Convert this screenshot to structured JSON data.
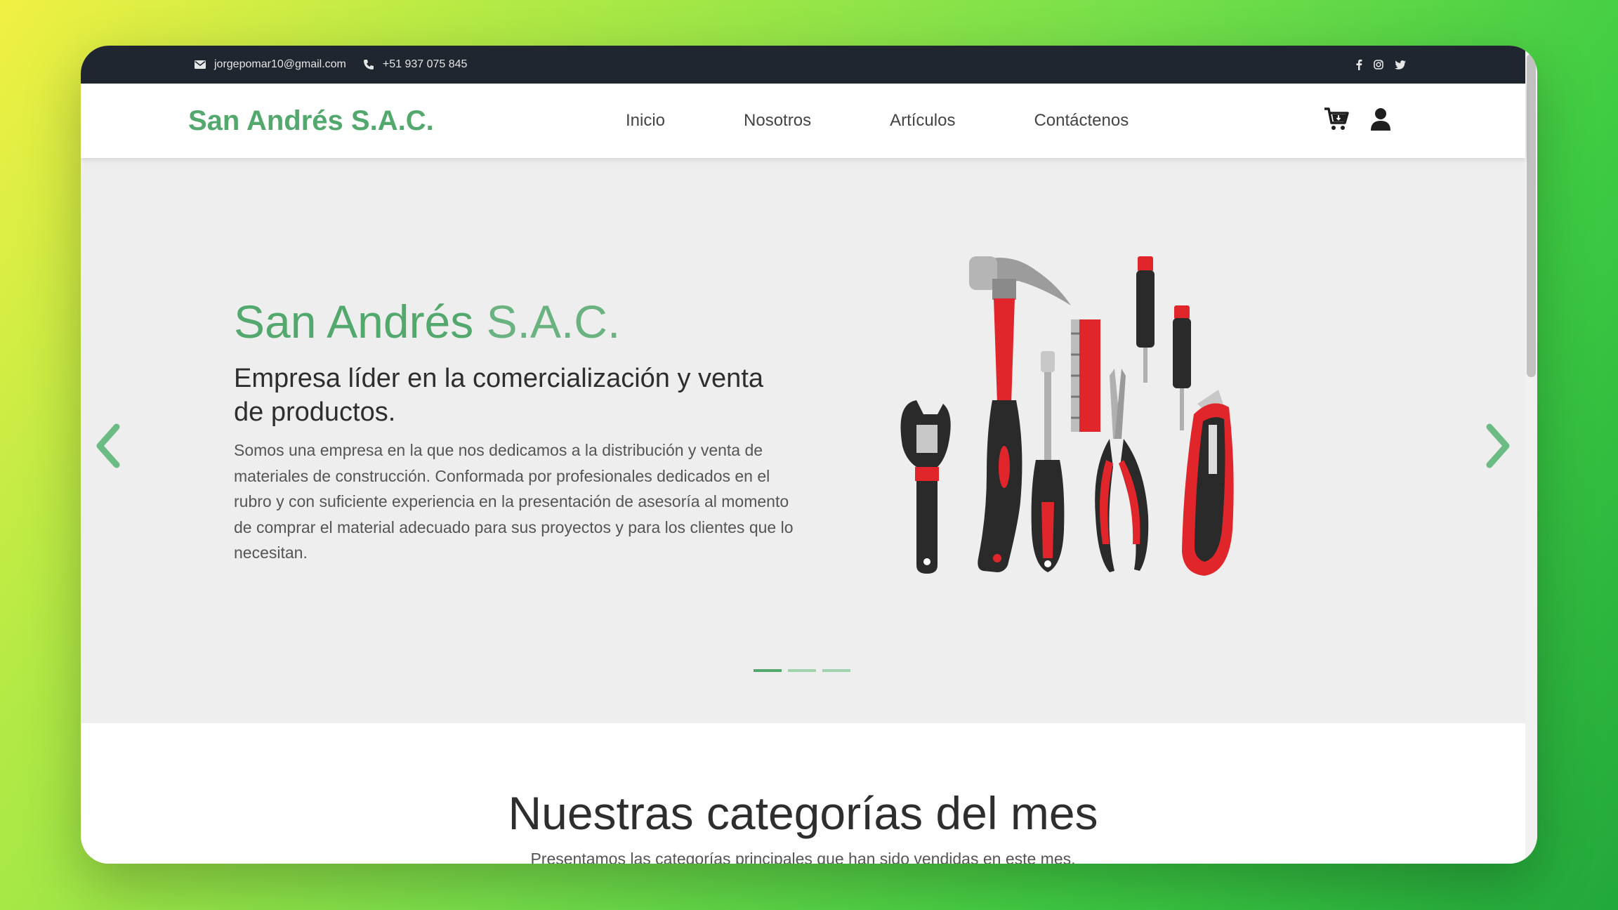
{
  "topbar": {
    "email": "jorgepomar10@gmail.com",
    "phone": "+51 937 075 845",
    "icons": [
      "envelope-icon",
      "phone-icon",
      "facebook-icon",
      "instagram-icon",
      "twitter-icon"
    ]
  },
  "nav": {
    "brand": "San Andrés S.A.C.",
    "links": [
      "Inicio",
      "Nosotros",
      "Artículos",
      "Contáctenos"
    ],
    "icons": [
      "cart-icon",
      "user-icon"
    ]
  },
  "hero": {
    "title_bold": "San Andrés",
    "title_light": "S.A.C.",
    "subtitle": "Empresa líder en la comercialización y venta de productos.",
    "description": "Somos una empresa en la que nos dedicamos a la distribución y venta de materiales de construcción. Conformada por profesionales dedicados en el rubro y con suficiente experiencia en la presentación de asesoría al momento de comprar el material adecuado para sus proyectos y para los clientes que lo necesitan.",
    "slides_total": 3,
    "slide_active": 1
  },
  "section": {
    "title": "Nuestras categorías del mes",
    "subtitle": "Presentamos las categorías principales que han sido vendidas en este mes."
  },
  "colors": {
    "brand_green": "#53a86d",
    "topbar_dark": "#1f2630",
    "hero_bg": "#eeeeee",
    "tool_red": "#e0262b"
  }
}
